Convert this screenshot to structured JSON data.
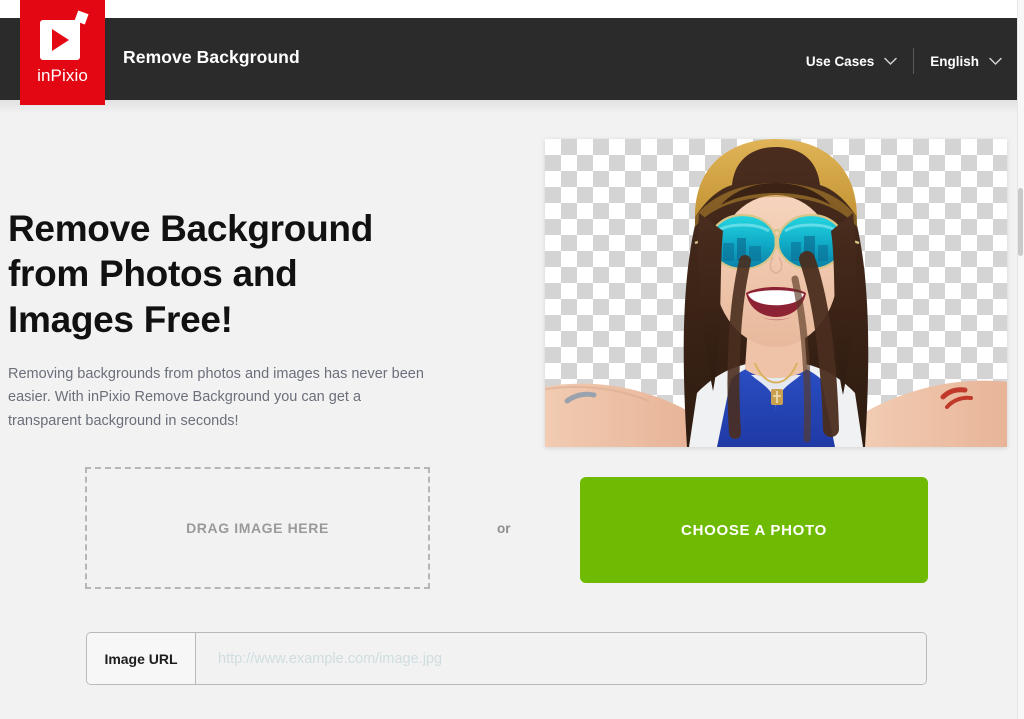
{
  "window": {
    "background_color": "#f2f2f2"
  },
  "header": {
    "background_color": "#2b2b2b",
    "title": "Remove Background",
    "logo": {
      "brand": "inPixio",
      "color": "#e30613"
    },
    "nav": [
      {
        "label": "Use Cases",
        "icon": "chevron-down-icon"
      },
      {
        "label": "English",
        "icon": "chevron-down-icon"
      }
    ]
  },
  "hero": {
    "headline_lines": [
      "Remove Background",
      "from Photos and",
      "Images Free!"
    ],
    "headline": "Remove Background from Photos and Images Free!",
    "description": "Removing backgrounds from photos and images has never been easier. With inPixio Remove Background you can get a transparent background in seconds!",
    "preview": {
      "alt": "Smiling woman wearing a straw hat and mirrored teal sunglasses, background removed showing transparency checkerboard",
      "checker_light": "#ffffff",
      "checker_dark": "#d4d4d4"
    }
  },
  "upload": {
    "dropzone_label": "DRAG IMAGE HERE",
    "separator_label": "or",
    "choose_button_label": "CHOOSE A PHOTO",
    "choose_button_color": "#6fba02",
    "url_field": {
      "label": "Image URL",
      "value": "",
      "placeholder": "http://www.example.com/image.jpg"
    }
  },
  "icons": {
    "chevron_down": "chevron-down-icon"
  }
}
